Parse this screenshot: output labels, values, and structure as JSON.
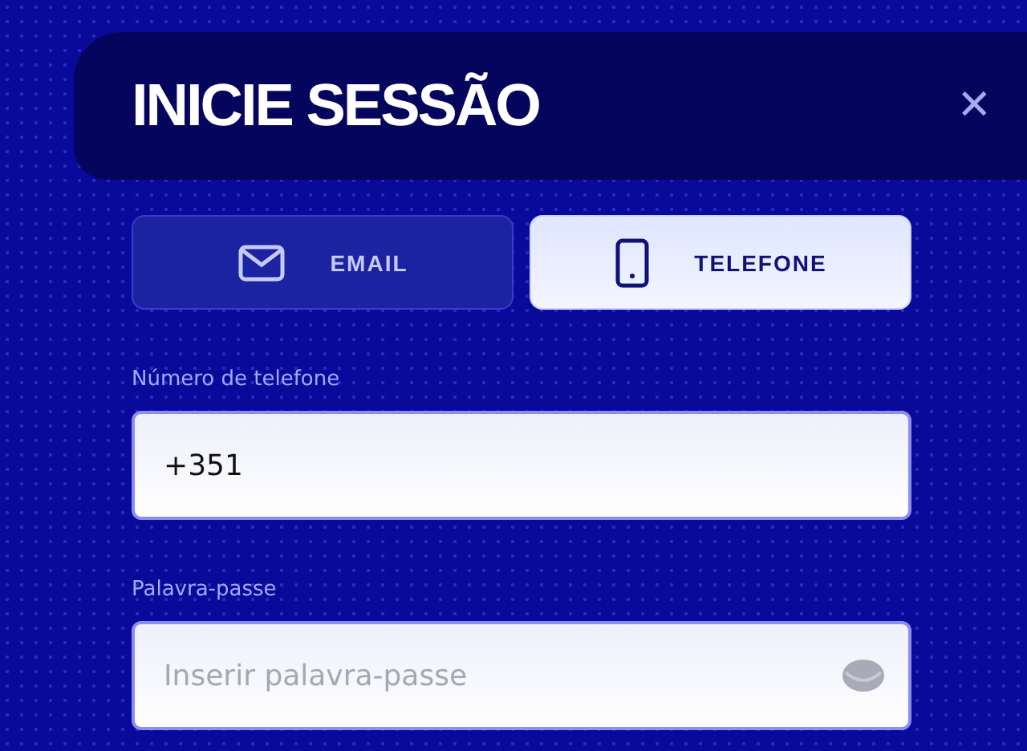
{
  "title": "INICIE SESSÃO",
  "close": "✕",
  "tabs": [
    {
      "kind": "email",
      "label": "EMAIL",
      "selected": false
    },
    {
      "kind": "phone",
      "label": "TELEFONE",
      "selected": true
    }
  ],
  "fields": [
    {
      "kind": "phone",
      "label": "Número de telefone",
      "value": "+351"
    },
    {
      "kind": "password",
      "label": "Palavra-passe",
      "placeholder": "Inserir palavra-passe"
    }
  ]
}
